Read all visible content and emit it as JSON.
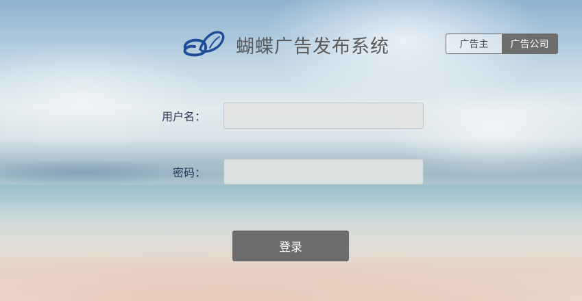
{
  "app": {
    "title": "蝴蝶广告发布系统",
    "logo_icon": "butterfly-logo-icon",
    "brand_color": "#1f4e99"
  },
  "role_switch": {
    "options": [
      {
        "label": "广告主",
        "active": false
      },
      {
        "label": "广告公司",
        "active": true
      }
    ]
  },
  "form": {
    "username_label": "用户名：",
    "username_value": "",
    "password_label": "密码：",
    "password_value": ""
  },
  "login_button": {
    "label": "登录"
  },
  "colors": {
    "button_bg": "#6c6c6c",
    "label_text": "#2a3a5a",
    "title_text": "#5a5a5a"
  }
}
